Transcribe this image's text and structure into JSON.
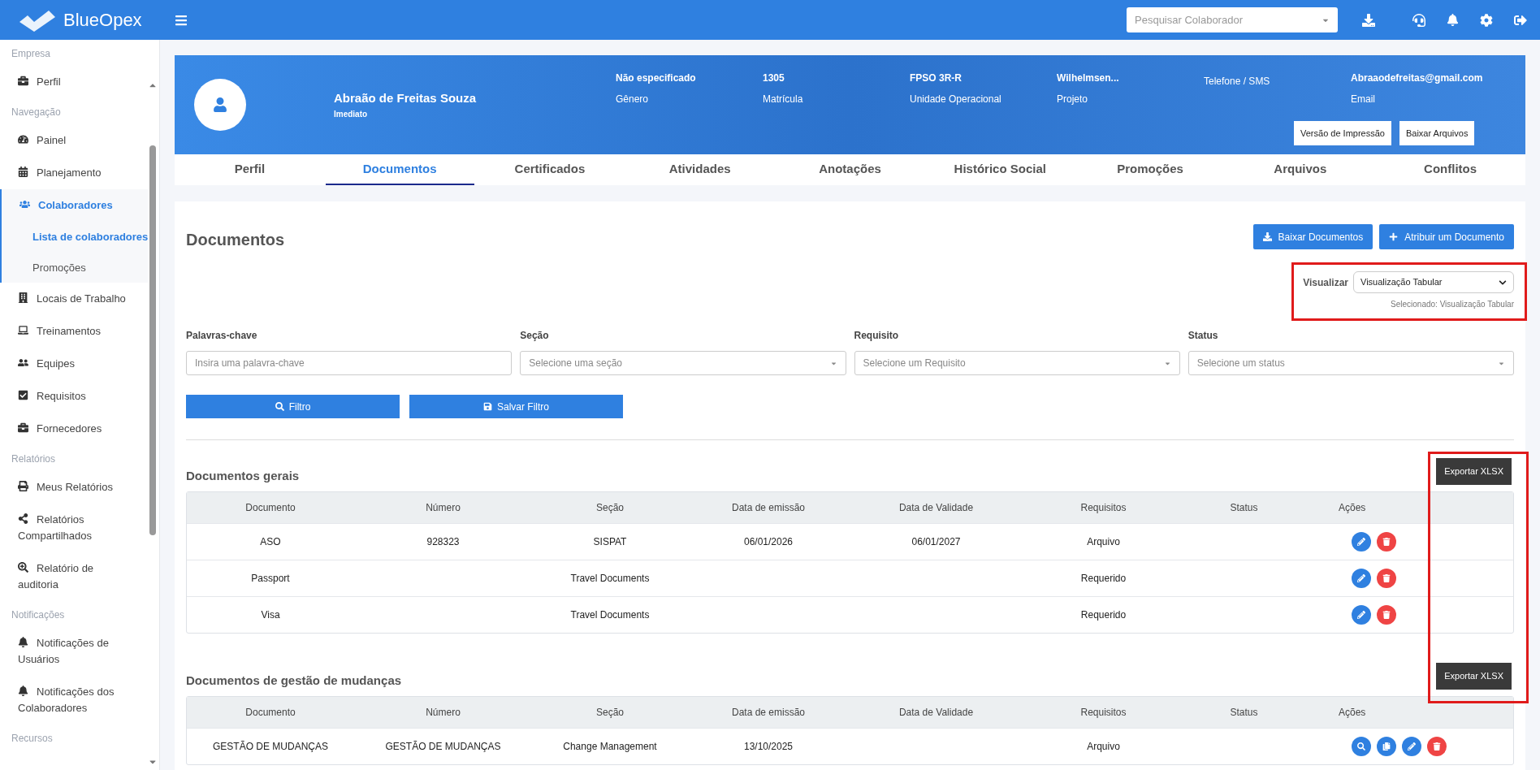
{
  "brand": "BlueOpex",
  "search": {
    "placeholder": "Pesquisar Colaborador"
  },
  "sidebar": [
    {
      "kind": "section",
      "label": "Empresa"
    },
    {
      "kind": "item",
      "label": "Perfil",
      "selected": false
    },
    {
      "kind": "section",
      "label": "Navegação"
    },
    {
      "kind": "item",
      "label": "Painel",
      "selected": false
    },
    {
      "kind": "item",
      "label": "Planejamento",
      "selected": false
    },
    {
      "kind": "item",
      "label": "Colaboradores",
      "selected": true
    },
    {
      "kind": "subitem",
      "label": "Lista de colaboradores",
      "selected": true
    },
    {
      "kind": "subitem",
      "label": "Promoções",
      "selected": false
    },
    {
      "kind": "item",
      "label": "Locais de Trabalho",
      "selected": false
    },
    {
      "kind": "item",
      "label": "Treinamentos",
      "selected": false
    },
    {
      "kind": "item",
      "label": "Equipes",
      "selected": false
    },
    {
      "kind": "item",
      "label": "Requisitos",
      "selected": false
    },
    {
      "kind": "item",
      "label": "Fornecedores",
      "selected": false
    },
    {
      "kind": "section",
      "label": "Relatórios"
    },
    {
      "kind": "item",
      "label": "Meus Relatórios",
      "selected": false
    },
    {
      "kind": "item",
      "label": "Relatórios Compartilhados",
      "selected": false
    },
    {
      "kind": "item",
      "label": "Relatório de auditoria",
      "selected": false
    },
    {
      "kind": "section",
      "label": "Notificações"
    },
    {
      "kind": "item",
      "label": "Notificações de Usuários",
      "selected": false
    },
    {
      "kind": "item",
      "label": "Notificações dos Colaboradores",
      "selected": false
    },
    {
      "kind": "section",
      "label": "Recursos"
    }
  ],
  "profile": {
    "name": "Abraão de Freitas Souza",
    "subtitle": "Imediato",
    "fields": [
      {
        "value": "Não especificado",
        "label": "Gênero"
      },
      {
        "value": "1305",
        "label": "Matrícula"
      },
      {
        "value": "FPSO 3R-R",
        "label": "Unidade Operacional"
      },
      {
        "value": "Wilhelmsen...",
        "label": "Projeto"
      },
      {
        "label": "Telefone / SMS"
      },
      {
        "value": "Abraaodefreitas@gmail.com",
        "label": "Email"
      }
    ],
    "buttons": [
      "Versão de Impressão",
      "Baixar Arquivos"
    ]
  },
  "tabs": [
    {
      "label": "Perfil",
      "selected": false
    },
    {
      "label": "Documentos",
      "selected": true
    },
    {
      "label": "Certificados",
      "selected": false
    },
    {
      "label": "Atividades",
      "selected": false
    },
    {
      "label": "Anotações",
      "selected": false
    },
    {
      "label": "Histórico Social",
      "selected": false
    },
    {
      "label": "Promoções",
      "selected": false
    },
    {
      "label": "Arquivos",
      "selected": false
    },
    {
      "label": "Conflitos",
      "selected": false
    }
  ],
  "page_title": "Documentos",
  "top_buttons": [
    {
      "kind": "download",
      "label": "Baixar Documentos"
    },
    {
      "kind": "add",
      "label": "Atribuir um Documento"
    }
  ],
  "view": {
    "label": "Visualizar",
    "value": "Visualização Tabular",
    "note": "Selecionado: Visualização Tabular"
  },
  "filters": [
    {
      "kind": "text",
      "label": "Palavras-chave",
      "placeholder": "Insira uma palavra-chave"
    },
    {
      "kind": "select",
      "label": "Seção",
      "placeholder": "Selecione uma seção"
    },
    {
      "kind": "select",
      "label": "Requisito",
      "placeholder": "Selecione um Requisito"
    },
    {
      "kind": "select",
      "label": "Status",
      "placeholder": "Selecione um status"
    }
  ],
  "filter_buttons": [
    {
      "kind": "search",
      "label": "Filtro"
    },
    {
      "kind": "save",
      "label": "Salvar Filtro"
    }
  ],
  "sections": [
    {
      "title": "Documentos gerais",
      "export": "Exportar XLSX",
      "columns": [
        "Documento",
        "Número",
        "Seção",
        "Data de emissão",
        "Data de Validade",
        "Requisitos",
        "Status",
        "Ações"
      ],
      "rows": [
        {
          "cells": [
            "ASO",
            "928323",
            "SISPAT",
            "06/01/2026",
            "06/01/2027",
            "Arquivo",
            ""
          ],
          "actions": [
            {
              "kind": "edit"
            },
            {
              "kind": "delete"
            }
          ]
        },
        {
          "cells": [
            "Passport",
            "",
            "Travel Documents",
            "",
            "",
            "Requerido",
            ""
          ],
          "actions": [
            {
              "kind": "edit"
            },
            {
              "kind": "delete"
            }
          ]
        },
        {
          "cells": [
            "Visa",
            "",
            "Travel Documents",
            "",
            "",
            "Requerido",
            ""
          ],
          "actions": [
            {
              "kind": "edit"
            },
            {
              "kind": "delete"
            }
          ]
        }
      ]
    },
    {
      "title": "Documentos de gestão de mudanças",
      "export": "Exportar XLSX",
      "columns": [
        "Documento",
        "Número",
        "Seção",
        "Data de emissão",
        "Data de Validade",
        "Requisitos",
        "Status",
        "Ações"
      ],
      "rows": [
        {
          "cells": [
            "GESTÃO DE MUDANÇAS",
            "GESTÃO DE MUDANÇAS",
            "Change Management",
            "13/10/2025",
            "",
            "Arquivo",
            ""
          ],
          "actions": [
            {
              "kind": "view"
            },
            {
              "kind": "copy"
            },
            {
              "kind": "edit"
            },
            {
              "kind": "delete"
            }
          ]
        }
      ]
    }
  ]
}
